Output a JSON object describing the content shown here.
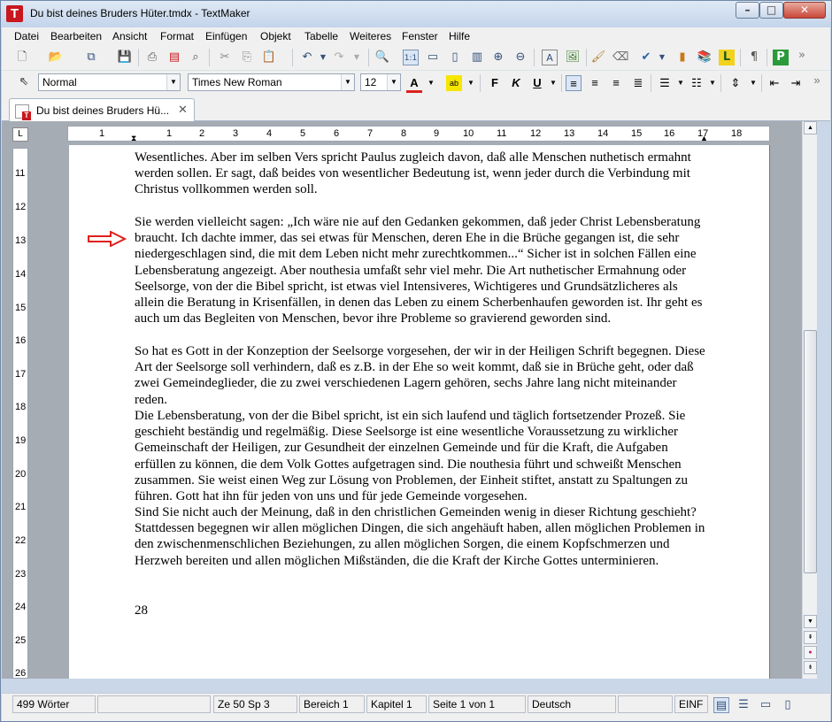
{
  "window": {
    "title": "Du bist deines Bruders Hüter.tmdx - TextMaker",
    "app_icon_letter": "T",
    "minimize_glyph": "–",
    "maximize_glyph": "□",
    "close_glyph": "✕"
  },
  "menu": [
    "Datei",
    "Bearbeiten",
    "Ansicht",
    "Format",
    "Einfügen",
    "Objekt",
    "Tabelle",
    "Weiteres",
    "Fenster",
    "Hilfe"
  ],
  "format_toolbar": {
    "style": "Normal",
    "font": "Times New Roman",
    "size": "12",
    "bold": "F",
    "italic": "K",
    "underline": "U"
  },
  "doc_tab": {
    "label": "Du bist deines Bruders Hü...",
    "close": "✕"
  },
  "ruler": {
    "corner": "L",
    "h_marks": [
      "1",
      "1",
      "2",
      "3",
      "4",
      "5",
      "6",
      "7",
      "8",
      "9",
      "10",
      "11",
      "12",
      "13",
      "14",
      "15",
      "16",
      "17",
      "18"
    ],
    "v_marks": [
      "11",
      "12",
      "13",
      "14",
      "15",
      "16",
      "17",
      "18",
      "19",
      "20",
      "21",
      "22",
      "23",
      "24",
      "25",
      "26"
    ]
  },
  "document": {
    "paragraphs": [
      "Wesentliches. Aber im selben Vers spricht Paulus zugleich davon, daß alle Menschen nuthetisch ermahnt werden sollen. Er sagt, daß beides von wesentlicher Bedeutung ist, wenn jeder durch die Verbindung mit Christus vollkommen werden soll.",
      "Sie werden vielleicht sagen: „Ich wäre nie auf den Gedanken gekommen, daß jeder Christ Lebensberatung braucht. Ich dachte immer, das sei etwas für Menschen, deren Ehe in die Brüche gegangen ist, die sehr niedergeschlagen sind, die mit dem Leben nicht mehr zurechtkommen...“ Sicher ist in solchen Fällen eine Lebensberatung angezeigt. Aber nouthesia umfaßt sehr viel mehr. Die Art nuthetischer Ermahnung oder Seelsorge, von der die Bibel spricht, ist etwas viel Intensiveres, Wichtigeres und Grundsätzlicheres als allein die Beratung in Krisenfällen, in denen das Leben zu einem Scherbenhaufen geworden ist. Ihr geht es auch um das Begleiten von Menschen, bevor ihre Probleme so gravierend geworden sind.",
      "So hat es Gott in der Konzeption der Seelsorge vorgesehen, der wir in der Heiligen Schrift begegnen. Diese Art der Seelsorge soll verhindern, daß es z.B. in der Ehe so weit kommt, daß sie in Brüche geht, oder daß zwei Gemeindeglieder, die zu zwei verschiedenen Lagern gehören, sechs Jahre lang nicht miteinander reden.",
      "Die Lebensberatung, von der die Bibel spricht, ist ein sich laufend und täglich fortsetzender Prozeß. Sie geschieht beständig und regelmäßig. Diese Seelsorge ist eine wesentliche Voraussetzung zu wirklicher Gemeinschaft der Heiligen, zur Gesundheit der einzelnen Gemeinde und für die Kraft, die Aufgaben erfüllen zu können, die dem Volk Gottes aufgetragen sind. Die nouthesia führt und schweißt Menschen zusammen. Sie weist einen Weg zur Lösung von Problemen, der Einheit stiftet, anstatt zu Spaltungen zu führen. Gott hat ihn für jeden von uns und für jede Gemeinde vorgesehen.",
      "Sind Sie nicht auch der Meinung, daß in den christlichen Gemeinden wenig in dieser Richtung geschieht? Stattdessen begegnen wir allen möglichen Dingen, die sich angehäuft haben, allen möglichen Problemen in den zwischenmenschlichen Beziehungen, zu allen möglichen Sorgen, die einem Kopfschmerzen und Herzweh bereiten und allen möglichen Mißständen, die die Kraft der Kirche Gottes unterminieren."
    ],
    "page_number": "28"
  },
  "status": {
    "words": "499 Wörter",
    "position": "Ze 50 Sp 3",
    "area": "Bereich 1",
    "chapter": "Kapitel 1",
    "page": "Seite 1 von 1",
    "language": "Deutsch",
    "mode": "EINF"
  },
  "colors": {
    "annotation_arrow": "#e0201c",
    "title_bar": "#c3d4ea",
    "font_color_indicator": "#e0201c",
    "highlight_color": "#f6e600"
  }
}
